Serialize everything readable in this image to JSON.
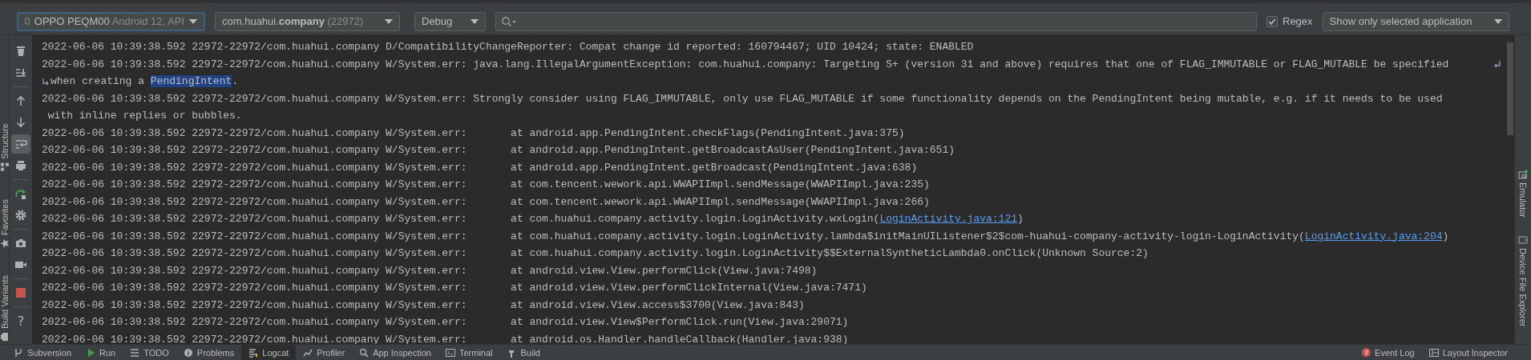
{
  "toolbar": {
    "device": {
      "name": "OPPO PEQM00",
      "detail": "Android 12, API"
    },
    "process": {
      "name": "com.huahui.**company**",
      "pid": "(22972)"
    },
    "log_level": "Debug",
    "regex": {
      "label": "Regex",
      "checked": true
    },
    "filter": "Show only selected application"
  },
  "left_strip": [
    {
      "kind": "structure",
      "label": "Structure"
    },
    {
      "kind": "favorites",
      "label": "Favorites"
    },
    {
      "kind": "variants",
      "label": "Build Variants"
    }
  ],
  "tools": [
    {
      "kind": "trash",
      "on": false
    },
    {
      "kind": "scroll-end",
      "on": false
    },
    {
      "kind": "up",
      "on": false
    },
    {
      "kind": "down",
      "on": false
    },
    {
      "kind": "soft-wrap",
      "on": true
    },
    {
      "kind": "print",
      "on": false
    },
    {
      "kind": "restart",
      "on": false
    },
    {
      "kind": "settings",
      "on": false
    },
    {
      "kind": "camera",
      "on": false
    },
    {
      "kind": "video",
      "on": false
    },
    {
      "kind": "stop",
      "on": false
    },
    {
      "kind": "help",
      "text": "?",
      "on": false
    }
  ],
  "log": [
    {
      "kind": "line",
      "segments": [
        {
          "kind": "plain",
          "text": "2022-06-06 10:39:38.592 22972-22972/com.huahui.company D/CompatibilityChangeReporter: Compat change id reported: 160794467; UID 10424; state: ENABLED"
        }
      ]
    },
    {
      "kind": "line",
      "wrap_mark": true,
      "segments": [
        {
          "kind": "plain",
          "text": "2022-06-06 10:39:38.592 22972-22972/com.huahui.company W/System.err: java.lang.IllegalArgumentException: com.huahui.company: Targeting S+ (version 31 and above) requires that one of FLAG_IMMUTABLE or FLAG_MUTABLE be specified"
        }
      ]
    },
    {
      "kind": "continued",
      "segments": [
        {
          "kind": "plain",
          "text": "when creating a "
        },
        {
          "kind": "highlight",
          "text": "PendingIntent"
        },
        {
          "kind": "plain",
          "text": "."
        }
      ]
    },
    {
      "kind": "line",
      "segments": [
        {
          "kind": "plain",
          "text": "2022-06-06 10:39:38.592 22972-22972/com.huahui.company W/System.err: Strongly consider using FLAG_IMMUTABLE, only use FLAG_MUTABLE if some functionality depends on the PendingIntent being mutable, e.g. if it needs to be used"
        }
      ]
    },
    {
      "kind": "line",
      "segments": [
        {
          "kind": "plain",
          "text": " with inline replies or bubbles."
        }
      ]
    },
    {
      "kind": "line",
      "segments": [
        {
          "kind": "plain",
          "text": "2022-06-06 10:39:38.592 22972-22972/com.huahui.company W/System.err:       at android.app.PendingIntent.checkFlags(PendingIntent.java:375)"
        }
      ]
    },
    {
      "kind": "line",
      "segments": [
        {
          "kind": "plain",
          "text": "2022-06-06 10:39:38.592 22972-22972/com.huahui.company W/System.err:       at android.app.PendingIntent.getBroadcastAsUser(PendingIntent.java:651)"
        }
      ]
    },
    {
      "kind": "line",
      "segments": [
        {
          "kind": "plain",
          "text": "2022-06-06 10:39:38.592 22972-22972/com.huahui.company W/System.err:       at android.app.PendingIntent.getBroadcast(PendingIntent.java:638)"
        }
      ]
    },
    {
      "kind": "line",
      "segments": [
        {
          "kind": "plain",
          "text": "2022-06-06 10:39:38.592 22972-22972/com.huahui.company W/System.err:       at com.tencent.wework.api.WWAPIImpl.sendMessage(WWAPIImpl.java:235)"
        }
      ]
    },
    {
      "kind": "line",
      "segments": [
        {
          "kind": "plain",
          "text": "2022-06-06 10:39:38.592 22972-22972/com.huahui.company W/System.err:       at com.tencent.wework.api.WWAPIImpl.sendMessage(WWAPIImpl.java:266)"
        }
      ]
    },
    {
      "kind": "line",
      "segments": [
        {
          "kind": "plain",
          "text": "2022-06-06 10:39:38.592 22972-22972/com.huahui.company W/System.err:       at com.huahui.company.activity.login.LoginActivity.wxLogin("
        },
        {
          "kind": "link",
          "text": "LoginActivity.java:121"
        },
        {
          "kind": "plain",
          "text": ")"
        }
      ]
    },
    {
      "kind": "line",
      "segments": [
        {
          "kind": "plain",
          "text": "2022-06-06 10:39:38.592 22972-22972/com.huahui.company W/System.err:       at com.huahui.company.activity.login.LoginActivity.lambda$initMainUIListener$2$com-huahui-company-activity-login-LoginActivity("
        },
        {
          "kind": "link",
          "text": "LoginActivity.java:204"
        },
        {
          "kind": "plain",
          "text": ")"
        }
      ]
    },
    {
      "kind": "line",
      "segments": [
        {
          "kind": "plain",
          "text": "2022-06-06 10:39:38.592 22972-22972/com.huahui.company W/System.err:       at com.huahui.company.activity.login.LoginActivity$$ExternalSyntheticLambda0.onClick(Unknown Source:2)"
        }
      ]
    },
    {
      "kind": "line",
      "segments": [
        {
          "kind": "plain",
          "text": "2022-06-06 10:39:38.592 22972-22972/com.huahui.company W/System.err:       at android.view.View.performClick(View.java:7498)"
        }
      ]
    },
    {
      "kind": "line",
      "segments": [
        {
          "kind": "plain",
          "text": "2022-06-06 10:39:38.592 22972-22972/com.huahui.company W/System.err:       at android.view.View.performClickInternal(View.java:7471)"
        }
      ]
    },
    {
      "kind": "line",
      "segments": [
        {
          "kind": "plain",
          "text": "2022-06-06 10:39:38.592 22972-22972/com.huahui.company W/System.err:       at android.view.View.access$3700(View.java:843)"
        }
      ]
    },
    {
      "kind": "line",
      "segments": [
        {
          "kind": "plain",
          "text": "2022-06-06 10:39:38.592 22972-22972/com.huahui.company W/System.err:       at android.view.View$PerformClick.run(View.java:29071)"
        }
      ]
    },
    {
      "kind": "line",
      "segments": [
        {
          "kind": "plain",
          "text": "2022-06-06 10:39:38.592 22972-22972/com.huahui.company W/System.err:       at android.os.Handler.handleCallback(Handler.java:938)"
        }
      ]
    }
  ],
  "right_strip": [
    {
      "kind": "emulator",
      "label": "Emulator"
    },
    {
      "kind": "files",
      "label": "Device File Explorer"
    }
  ],
  "bottom_tabs": [
    {
      "kind": "vcs",
      "label": "Subversion",
      "selected": false
    },
    {
      "kind": "run",
      "label": "Run",
      "selected": false
    },
    {
      "kind": "todo",
      "label": "TODO",
      "selected": false
    },
    {
      "kind": "problems",
      "label": "Problems",
      "selected": false
    },
    {
      "kind": "logcat",
      "label": "Logcat",
      "selected": true
    },
    {
      "kind": "profiler",
      "label": "Profiler",
      "selected": false
    },
    {
      "kind": "inspection",
      "label": "App Inspection",
      "selected": false
    },
    {
      "kind": "terminal",
      "label": "Terminal",
      "selected": false
    },
    {
      "kind": "build",
      "label": "Build",
      "selected": false
    }
  ],
  "bottom_right": [
    {
      "kind": "event-log",
      "label": "Event Log",
      "badge": "2"
    },
    {
      "kind": "layout",
      "label": "Layout Inspector"
    }
  ]
}
